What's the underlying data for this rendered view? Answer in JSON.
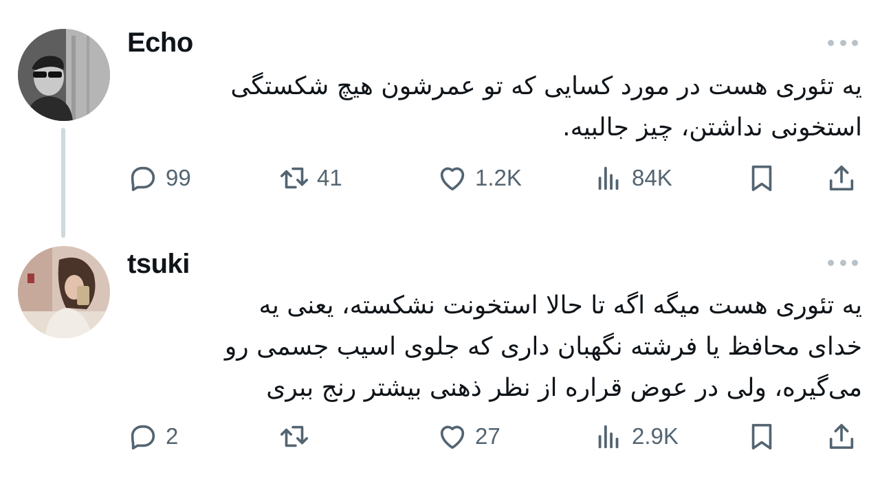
{
  "tweets": [
    {
      "username": "Echo",
      "text_lines": [
        "یه تئوری هست در مورد کسایی که تو عمرشون هیچ شکستگی",
        "استخونی نداشتن، چیز جالبیه."
      ],
      "replies": "99",
      "retweets": "41",
      "likes": "1.2K",
      "views": "84K"
    },
    {
      "username": "tsuki",
      "text_lines": [
        "یه تئوری هست میگه اگه تا حالا استخونت نشکسته، یعنی یه",
        "خدای محافظ یا فرشته نگهبان داری که جلوی اسیب جسمی رو",
        "می‌گیره، ولی در عوض قراره از نظر ذهنی بیشتر رنج ببری"
      ],
      "replies": "2",
      "retweets": "",
      "likes": "27",
      "views": "2.9K"
    }
  ],
  "icons": {
    "reply": "reply-icon",
    "retweet": "retweet-icon",
    "like": "heart-icon",
    "views": "views-icon",
    "bookmark": "bookmark-icon",
    "share": "share-icon",
    "more": "more-icon"
  },
  "colors": {
    "text": "#0f1419",
    "secondary": "#536471",
    "thread_line": "#cfd9de"
  }
}
